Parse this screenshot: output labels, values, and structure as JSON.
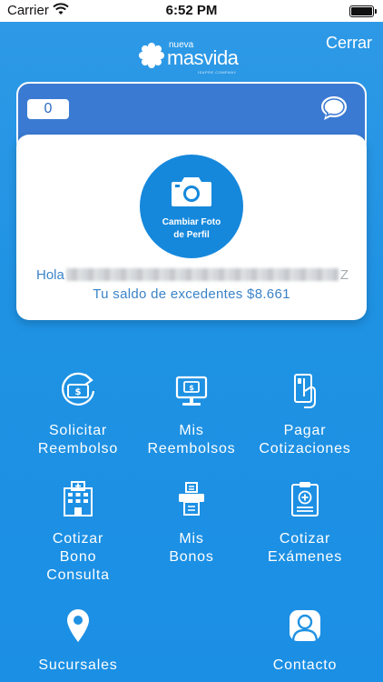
{
  "status_bar": {
    "carrier": "Carrier",
    "time": "6:52 PM"
  },
  "header": {
    "logo_small": "nueva",
    "logo_big": "masvida",
    "logo_tiny": "ISAPRE COMPANY",
    "close_label": "Cerrar"
  },
  "card": {
    "counter": "0",
    "photo_line1": "Cambiar Foto",
    "photo_line2": "de Perfil",
    "greeting": "Hola",
    "greeting_tail": "Z",
    "balance": "Tu saldo de excedentes $8.661"
  },
  "menu": [
    {
      "line1": "Solicitar",
      "line2": "Reembolso",
      "line3": "",
      "icon": "reimbursement-cycle-icon"
    },
    {
      "line1": "Mis",
      "line2": "Reembolsos",
      "line3": "",
      "icon": "monitor-money-icon"
    },
    {
      "line1": "Pagar",
      "line2": "Cotizaciones",
      "line3": "",
      "icon": "card-payment-icon"
    },
    {
      "line1": "Cotizar",
      "line2": "Bono",
      "line3": "Consulta",
      "icon": "hospital-icon"
    },
    {
      "line1": "Mis",
      "line2": "Bonos",
      "line3": "",
      "icon": "ticket-print-icon"
    },
    {
      "line1": "Cotizar",
      "line2": "Exámenes",
      "line3": "",
      "icon": "medical-clipboard-icon"
    },
    {
      "line1": "Sucursales",
      "line2": "",
      "line3": "",
      "icon": "location-pin-icon"
    },
    {
      "line1": "Contacto",
      "line2": "",
      "line3": "",
      "icon": "contact-person-icon"
    }
  ],
  "colors": {
    "accent": "#1b8fe4",
    "card_header": "#3b7ad2",
    "text_blue": "#3a83c8"
  }
}
